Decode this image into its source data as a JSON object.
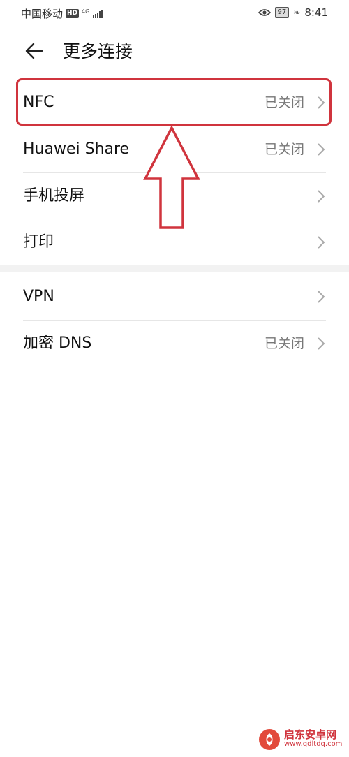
{
  "status_bar": {
    "carrier": "中国移动",
    "hd_badge": "HD",
    "network": "4G",
    "battery": "97",
    "time": "8:41"
  },
  "header": {
    "back_icon": "arrow-left-icon",
    "title": "更多连接"
  },
  "settings": {
    "section1": [
      {
        "label": "NFC",
        "value": "已关闭"
      },
      {
        "label": "Huawei Share",
        "value": "已关闭"
      },
      {
        "label": "手机投屏",
        "value": ""
      },
      {
        "label": "打印",
        "value": ""
      }
    ],
    "section2": [
      {
        "label": "VPN",
        "value": ""
      },
      {
        "label": "加密 DNS",
        "value": "已关闭"
      }
    ]
  },
  "annotation": {
    "highlight_color": "#d0343d"
  },
  "watermark": {
    "name": "启东安卓网",
    "url": "www.qdltdq.com"
  }
}
